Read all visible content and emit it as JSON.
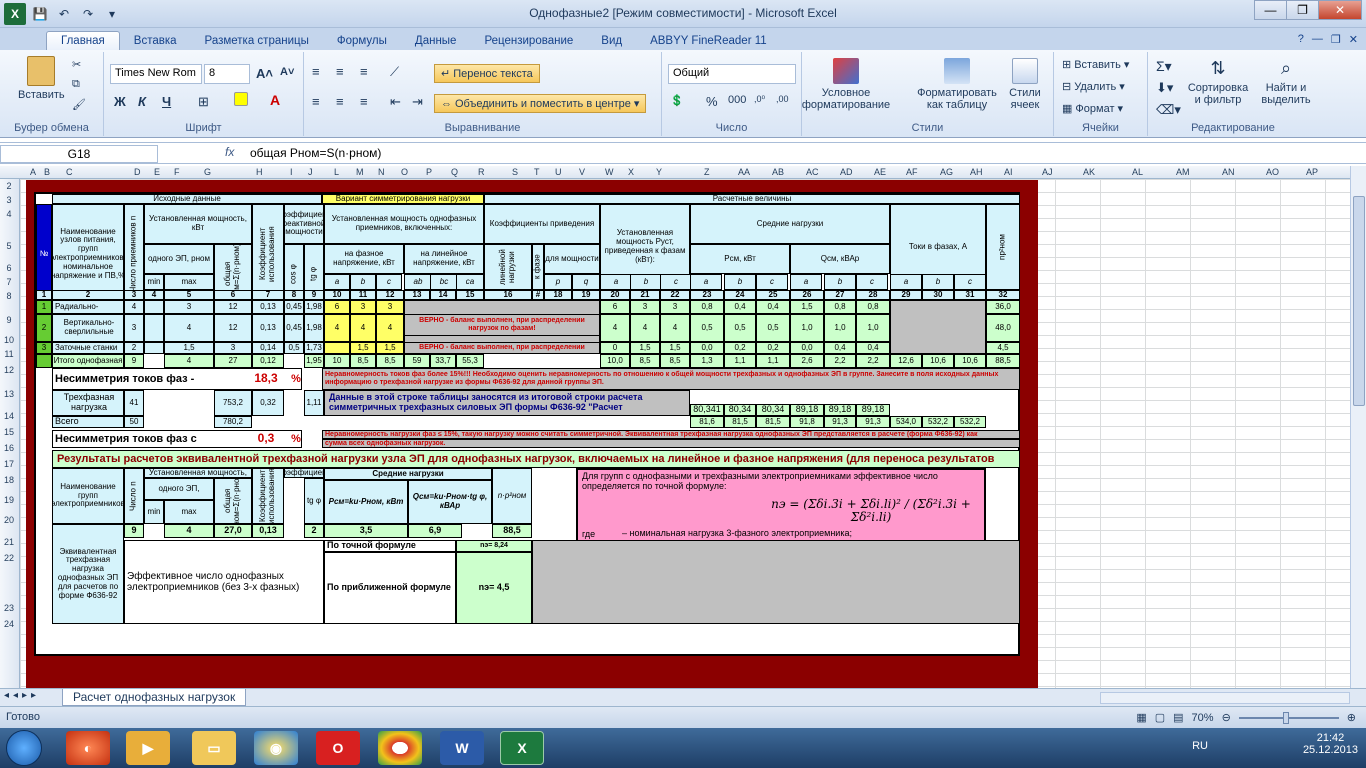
{
  "window": {
    "title": "Однофазные2  [Режим совместимости] - Microsoft Excel"
  },
  "tabs": [
    "Главная",
    "Вставка",
    "Разметка страницы",
    "Формулы",
    "Данные",
    "Рецензирование",
    "Вид",
    "ABBYY FineReader 11"
  ],
  "ribbon": {
    "clipboard": {
      "paste": "Вставить",
      "label": "Буфер обмена"
    },
    "font": {
      "name": "Times New Rom",
      "size": "8",
      "bold": "Ж",
      "italic": "К",
      "underline": "Ч",
      "label": "Шрифт"
    },
    "alignment": {
      "wrap": "Перенос текста",
      "merge": "Объединить и поместить в центре",
      "label": "Выравнивание"
    },
    "number": {
      "format": "Общий",
      "percent": "%",
      "thousands": "000",
      "label": "Число"
    },
    "styles": {
      "conditional": "Условное форматирование",
      "table": "Форматировать как таблицу",
      "cell": "Стили ячеек",
      "label": "Стили"
    },
    "cells": {
      "insert": "Вставить",
      "delete": "Удалить",
      "format": "Формат",
      "label": "Ячейки"
    },
    "editing": {
      "sort": "Сортировка и фильтр",
      "find": "Найти и выделить",
      "label": "Редактирование"
    }
  },
  "formula": {
    "namebox": "G18",
    "fx": "fx",
    "content": "общая Pном=S(n·pном)"
  },
  "columns": [
    "A",
    "B",
    "C",
    "D",
    "E",
    "F",
    "G",
    "H",
    "I",
    "J",
    "L",
    "M",
    "N",
    "O",
    "P",
    "Q",
    "R",
    "S",
    "T",
    "U",
    "V",
    "W",
    "X",
    "Y",
    "Z",
    "AA",
    "AB",
    "AC",
    "AD",
    "AE",
    "AF",
    "AG",
    "AH",
    "AI",
    "AJ",
    "AK",
    "AL",
    "AM",
    "AN",
    "AO",
    "AP"
  ],
  "rows": [
    "2",
    "3",
    "4",
    "5",
    "6",
    "7",
    "8",
    "9",
    "10",
    "11",
    "12",
    "13",
    "14",
    "15",
    "16",
    "17",
    "18",
    "19",
    "20",
    "21",
    "22",
    "23",
    "24"
  ],
  "sheet": {
    "h_source": "Исходные данные",
    "h_variant": "Вариант симметрирования нагрузки",
    "h_calc": "Расчетные величины",
    "name_col": "Наименование узлов питания, групп электроприемников, номинальное напряжение и ПВ,%",
    "num": "№",
    "count": "Число приемников n",
    "power": "Установленная мощность, кВт",
    "one_ep": "одного ЭП, pном",
    "total": "общая Pном=Σ(n·pном)",
    "ku": "Коэффициент использования",
    "koef_r": "Коэффициент реактивной мощности",
    "cos": "cos φ",
    "tg": "tg φ",
    "sym_power": "Установленная мощность однофазных приемников, включенных:",
    "phase_v": "на фазное напряжение, кВт",
    "line_v": "на линейное напряжение, кВт",
    "koef_priv": "Коэффициенты приведения",
    "line_load": "линейной нагрузки",
    "kpriv": "к фазе",
    "for_power": "для мощности",
    "inst_phase": "Установленная мощность Pуст, приведенная к фазам (кВт):",
    "avg_load": "Средние нагрузки",
    "pcm": "Pсм, кВт",
    "qcm": "Qсм, кВАр",
    "phase_current": "Токи в фазах, А",
    "np2": "np²ном",
    "min": "min",
    "max": "max",
    "a": "a",
    "b": "b",
    "c": "c",
    "ab": "ab",
    "bc": "bc",
    "ca": "ca",
    "p": "p",
    "q": "q",
    "idx": [
      "1",
      "2",
      "3",
      "4",
      "5",
      "6",
      "7",
      "8",
      "9",
      "10",
      "11",
      "12",
      "13",
      "14",
      "15",
      "16",
      "#",
      "18",
      "19",
      "20",
      "21",
      "22",
      "23",
      "24",
      "25",
      "26",
      "27",
      "28",
      "29",
      "30",
      "31",
      "32"
    ],
    "r1": {
      "n": "1",
      "name": "Радиально-",
      "cnt": "4",
      "min": "",
      "max": "3",
      "tot": "12",
      "ku": "0,13",
      "cos": "0,45",
      "tg": "1,98",
      "a": "6",
      "b": "3",
      "c": "3",
      "pa": "6",
      "pb": "3",
      "pc": "3",
      "sa": "0,8",
      "sb": "0,4",
      "sc": "0,4",
      "qa": "1,5",
      "qb": "0,8",
      "qc": "0,8",
      "np": "36,0"
    },
    "r2": {
      "n": "2",
      "name": "Вертикально-сверлильные",
      "cnt": "3",
      "max": "4",
      "tot": "12",
      "ku": "0,13",
      "cos": "0,45",
      "tg": "1,98",
      "a": "4",
      "b": "4",
      "c": "4",
      "pa": "4",
      "pb": "4",
      "pc": "4",
      "sa": "0,5",
      "sb": "0,5",
      "sc": "0,5",
      "qa": "1,0",
      "qb": "1,0",
      "qc": "1,0",
      "np": "48,0"
    },
    "r3": {
      "n": "3",
      "name": "Заточные станки",
      "cnt": "2",
      "max": "1,5",
      "tot": "3",
      "ku": "0,14",
      "cos": "0,5",
      "tg": "1,73",
      "b": "1,5",
      "c": "1,5",
      "pa": "0",
      "pb": "1,5",
      "pc": "1,5",
      "sa": "0,0",
      "sb": "0,2",
      "sc": "0,2",
      "qa": "0,0",
      "qb": "0,4",
      "qc": "0,4",
      "np": "4,5"
    },
    "msg_ok": "ВЕРНО - баланс выполнен, при распределении нагрузок по фазам!",
    "msg_ok2": "ВЕРНО - баланс выполнен, при распределении",
    "r11": {
      "name": "Итого однофазная",
      "cnt": "9",
      "max": "4",
      "tot": "27",
      "ku": "0,12",
      "tg": "1,95",
      "a": "10",
      "b": "8,5",
      "c": "8,5",
      "ab": "59",
      "bc": "33,7",
      "ca": "55,3",
      "pa": "10,0",
      "pb": "8,5",
      "pc": "8,5",
      "sa": "1,3",
      "sb": "1,1",
      "sc": "1,1",
      "qa": "2,6",
      "qb": "2,2",
      "qc": "2,2",
      "ia": "12,6",
      "ib": "10,6",
      "ic": "10,6",
      "np": "88,5"
    },
    "asym_label": "Несимметрия токов фаз -",
    "asym_val": "18,3",
    "pct": "%",
    "asym_msg": "Неравномерность токов фаз более 15%!!! Необходимо оценить неравномерность по отношению к общей мощности трехфазных и однофазных ЭП в группе. Занесите в поля исходных данных информацию о трехфазной нагрузке из формы Ф636-92 для данной группы ЭП.",
    "r13": {
      "name": "Трехфазная нагрузка",
      "cnt": "41",
      "tot": "753,2",
      "ku": "0,32",
      "tg": "1,11",
      "info": "Данные в этой строке таблицы заносятся из итоговой строки расчета симметричных трехфазных силовых ЭП формы Ф636-92 \"Расчет",
      "sa": "80,341",
      "sb": "80,34",
      "sc": "80,34",
      "qa": "89,18",
      "qb": "89,18",
      "qc": "89,18"
    },
    "r14": {
      "name": "Всего",
      "cnt": "50",
      "tot": "780,2",
      "sa": "81,6",
      "sb": "81,5",
      "sc": "81,5",
      "qa": "91,8",
      "qb": "91,3",
      "qc": "91,3",
      "ia": "534,0",
      "ib": "532,2",
      "ic": "532,2"
    },
    "asym2_label": "Несимметрия токов фаз с",
    "asym2_val": "0,3",
    "asym2_msg": "Неравномерность нагрузки фаз ≤ 15%, такую нагрузку можно считать симметричной. Эквивалентная трехфазная нагрузка однофазных ЭП представляется в расчете (форма Ф636-92) как",
    "asym2_msg2": "сумма всех однофазных нагрузок.",
    "results_title": "Результаты расчетов эквивалентной трехфазной нагрузки узла ЭП для однофазных нагрузок, включаемых на линейное и фазное напряжения (для переноса результатов",
    "res_name": "Наименование групп электроприемников",
    "res_count": "Число n",
    "res_power": "Установленная мощность,",
    "res_one": "одного ЭП,",
    "res_total": "общая Pном=Σ(n·pном)",
    "res_ku": "Коэффициент использования",
    "res_kr": "Коэффициент",
    "res_tg": "tg φ",
    "res_avg": "Средние нагрузки",
    "res_p": "Pсм=kи·Pном, кВт",
    "res_q": "Qсм=kи·Pном·tg φ, кВАр",
    "res_np": "n·p²ном",
    "formula_text": "Для групп с однофазными и трехфазными электроприемниками эффективное число определяется по точной формуле:",
    "formula_where": "где",
    "formula_desc": "– номинальная нагрузка 3-фазного электроприемника;",
    "res_row_name": "Эквивалентная трехфазная нагрузка однофазных ЭП для расчетов по форме Ф636-92",
    "res_row": {
      "cnt": "9",
      "max": "4",
      "tot": "27,0",
      "ku": "0,13",
      "tg": "2",
      "p": "3,5",
      "q": "6,9",
      "np": "88,5"
    },
    "eff_label": "Эффективное число однофазных электроприемников (без 3-х фазных)",
    "exact": "По точной формуле",
    "exact_val": "nэ= 8,24",
    "approx": "По приближенной формуле",
    "approx_val": "nэ= 4,5"
  },
  "sheet_tab": "Расчет однофазных нагрузок",
  "status": {
    "ready": "Готово",
    "zoom": "70%"
  },
  "tray": {
    "lang": "RU",
    "time": "21:42",
    "date": "25.12.2013"
  }
}
